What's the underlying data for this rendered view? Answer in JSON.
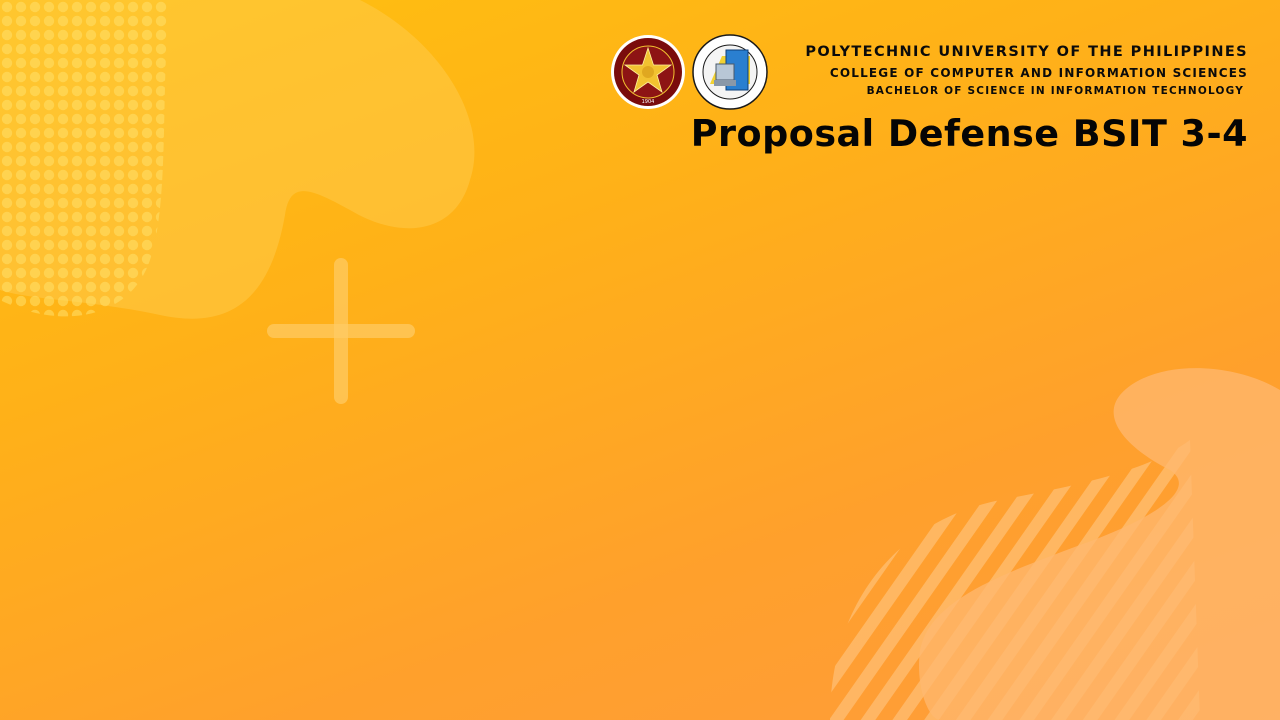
{
  "header": {
    "university": "POLYTECHNIC UNIVERSITY OF THE PHILIPPINES",
    "college": "COLLEGE OF COMPUTER AND INFORMATION SCIENCES",
    "program": "BACHELOR OF SCIENCE IN INFORMATION TECHNOLOGY",
    "title": "Proposal Defense BSIT 3-4"
  },
  "logos": [
    {
      "name": "pup-seal-icon",
      "year": "1904"
    },
    {
      "name": "ccis-seal-icon"
    }
  ],
  "colors": {
    "background_start": "#ffc10f",
    "background_end": "#ff9c3c",
    "text": "#0b0b0b",
    "pup_maroon": "#7a0c0c",
    "pup_gold": "#f2c230",
    "ccis_blue": "#2a7fd0"
  }
}
